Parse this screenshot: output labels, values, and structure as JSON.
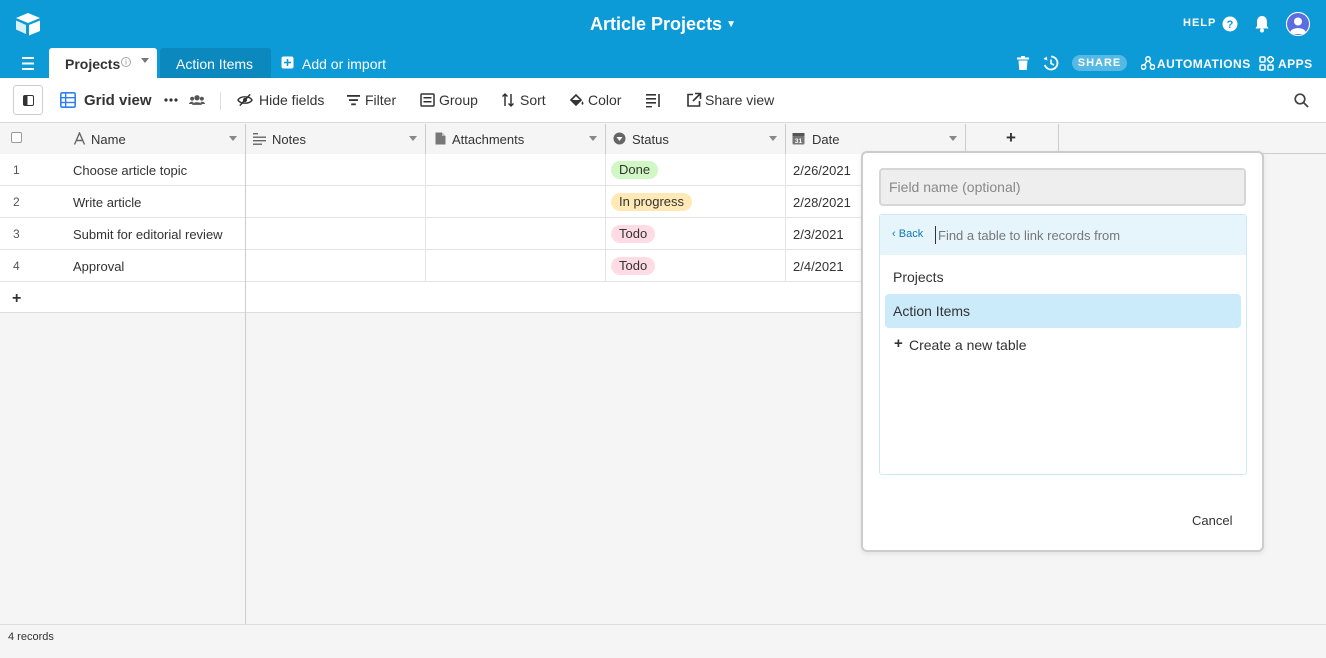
{
  "app": {
    "base_title": "Article Projects",
    "help_label": "HELP"
  },
  "tabs": [
    {
      "label": "Projects",
      "active": true
    },
    {
      "label": "Action Items",
      "active": false
    }
  ],
  "add_import_label": "Add or import",
  "header_actions": {
    "share_label": "SHARE",
    "automations_label": "AUTOMATIONS",
    "apps_label": "APPS"
  },
  "toolbar": {
    "view_name": "Grid view",
    "hide_fields": "Hide fields",
    "filter": "Filter",
    "group": "Group",
    "sort": "Sort",
    "color": "Color",
    "share_view": "Share view"
  },
  "columns": [
    {
      "label": "Name",
      "icon": "text-a-icon"
    },
    {
      "label": "Notes",
      "icon": "long-text-icon"
    },
    {
      "label": "Attachments",
      "icon": "document-icon"
    },
    {
      "label": "Status",
      "icon": "single-select-icon"
    },
    {
      "label": "Date",
      "icon": "calendar-icon"
    }
  ],
  "rows": [
    {
      "num": "1",
      "name": "Choose article topic",
      "status": "Done",
      "date": "2/26/2021"
    },
    {
      "num": "2",
      "name": "Write article",
      "status": "In progress",
      "date": "2/28/2021"
    },
    {
      "num": "3",
      "name": "Submit for editorial review",
      "status": "Todo",
      "date": "2/3/2021"
    },
    {
      "num": "4",
      "name": "Approval",
      "status": "Todo",
      "date": "2/4/2021"
    }
  ],
  "status_colors": {
    "Done": "#d1f7c4",
    "In progress": "#ffeab6",
    "Todo": "#ffdce5"
  },
  "add_column_label": "+",
  "add_row_label": "+",
  "footer": {
    "record_count": "4 records"
  },
  "popup": {
    "field_name_placeholder": "Field name (optional)",
    "back_label": "Back",
    "find_placeholder": "Find a table to link records from",
    "options": [
      "Projects",
      "Action Items"
    ],
    "create_label": "Create a new table",
    "cancel_label": "Cancel"
  },
  "colors": {
    "brand": "#0d9bd7",
    "tab_inactive": "#0b88be",
    "selected_option": "#cbeafa"
  }
}
